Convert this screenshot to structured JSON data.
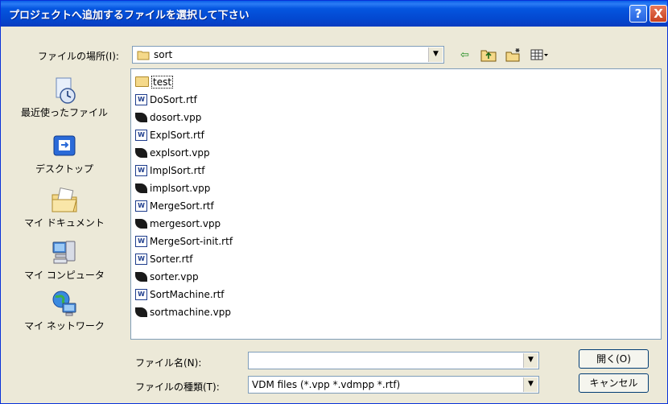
{
  "dialog": {
    "title": "プロジェクトへ追加するファイルを選択して下さい",
    "help_label": "?",
    "close_label": "X"
  },
  "location": {
    "label": "ファイルの場所(I):",
    "value": "sort"
  },
  "toolbar": {
    "back_icon": "back-arrow-icon",
    "up_icon": "up-folder-icon",
    "new_folder_icon": "new-folder-icon",
    "view_icon": "view-menu-icon"
  },
  "places": [
    {
      "label": "最近使ったファイル",
      "icon": "recent-files-icon"
    },
    {
      "label": "デスクトップ",
      "icon": "desktop-icon"
    },
    {
      "label": "マイ ドキュメント",
      "icon": "my-documents-icon"
    },
    {
      "label": "マイ コンピュータ",
      "icon": "my-computer-icon"
    },
    {
      "label": "マイ ネットワーク",
      "icon": "my-network-icon"
    }
  ],
  "files": [
    {
      "name": "test",
      "type": "folder"
    },
    {
      "name": "DoSort.rtf",
      "type": "rtf"
    },
    {
      "name": "dosort.vpp",
      "type": "vpp"
    },
    {
      "name": "ExplSort.rtf",
      "type": "rtf"
    },
    {
      "name": "explsort.vpp",
      "type": "vpp"
    },
    {
      "name": "ImplSort.rtf",
      "type": "rtf"
    },
    {
      "name": "implsort.vpp",
      "type": "vpp"
    },
    {
      "name": "MergeSort.rtf",
      "type": "rtf"
    },
    {
      "name": "mergesort.vpp",
      "type": "vpp"
    },
    {
      "name": "MergeSort-init.rtf",
      "type": "rtf"
    },
    {
      "name": "Sorter.rtf",
      "type": "rtf"
    },
    {
      "name": "sorter.vpp",
      "type": "vpp"
    },
    {
      "name": "SortMachine.rtf",
      "type": "rtf"
    },
    {
      "name": "sortmachine.vpp",
      "type": "vpp"
    }
  ],
  "filename": {
    "label": "ファイル名(N):",
    "value": ""
  },
  "filetype": {
    "label": "ファイルの種類(T):",
    "value": "VDM files (*.vpp *.vdmpp *.rtf)"
  },
  "buttons": {
    "open_label": "開く(O)",
    "cancel_label": "キャンセル"
  },
  "colors": {
    "titlebar": "#0348d0",
    "dialog_bg": "#ece9d8",
    "close": "#c8401e"
  }
}
